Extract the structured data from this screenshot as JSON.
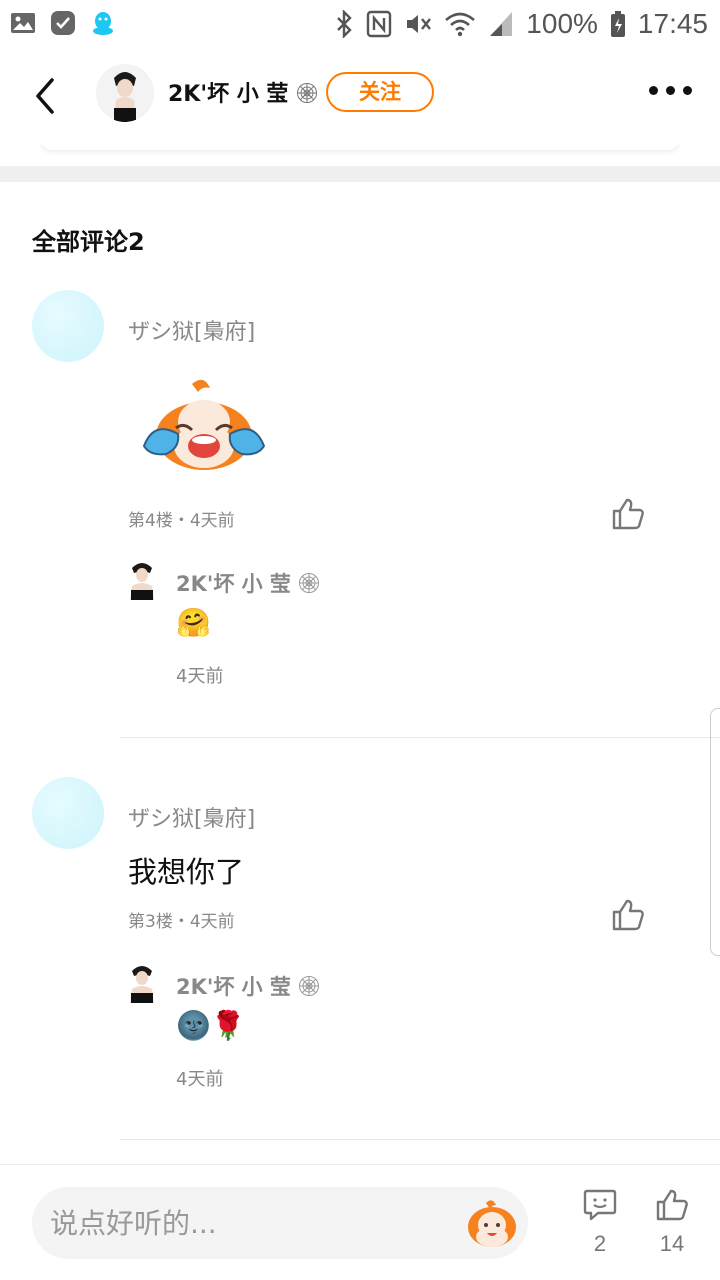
{
  "status_bar": {
    "battery": "100%",
    "time": "17:45"
  },
  "header": {
    "user_name": "2K'坏 小 莹",
    "follow_label": "关注"
  },
  "section": {
    "title": "全部评论2"
  },
  "comments": [
    {
      "user": "ザシ狱[梟府]",
      "content": "",
      "sticker": "crying-mascot-sticker",
      "meta": "第4楼・4天前",
      "reply": {
        "user": "2K'坏 小 莹",
        "emoji": "🤗",
        "time": "4天前"
      }
    },
    {
      "user": "ザシ狱[梟府]",
      "content": "我想你了",
      "meta": "第3楼・4天前",
      "reply": {
        "user": "2K'坏 小 莹",
        "emoji": "🌚🌹",
        "time": "4天前"
      }
    }
  ],
  "bottom": {
    "placeholder": "说点好听的...",
    "comment_count": "2",
    "like_count": "14"
  },
  "colors": {
    "accent": "#ff7a00",
    "avatar_placeholder": "#ccf4fb",
    "secondary_text": "#888888"
  }
}
